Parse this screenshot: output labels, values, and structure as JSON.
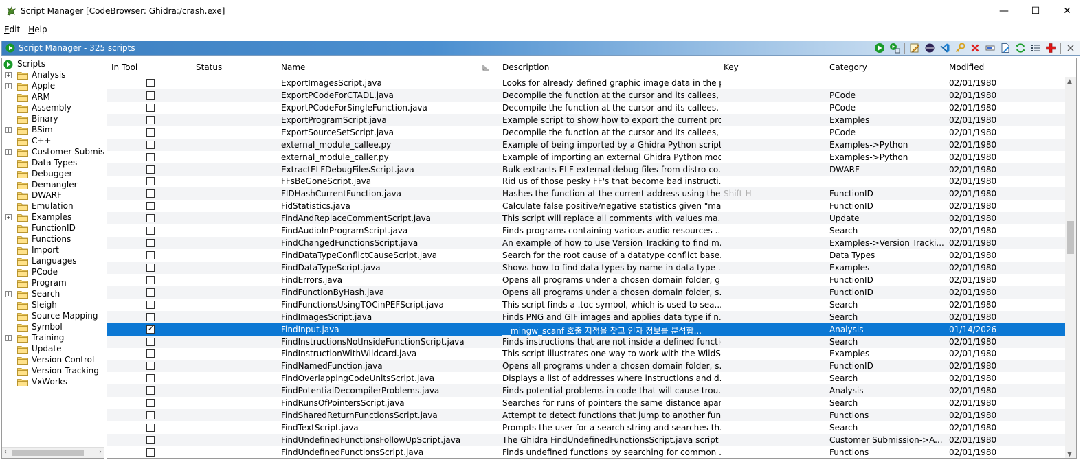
{
  "window": {
    "title": "Script Manager [CodeBrowser: Ghidra:/crash.exe]",
    "minimize": "—",
    "maximize": "☐",
    "close": "✕"
  },
  "menu": [
    {
      "label": "Edit",
      "mnemonic": "E",
      "rest": "dit"
    },
    {
      "label": "Help",
      "mnemonic": "H",
      "rest": "elp"
    }
  ],
  "panel": {
    "title": "Script Manager - 325 scripts"
  },
  "toolbar_icons": [
    "run-script-icon",
    "run-last-script-icon",
    "edit-script-icon",
    "eclipse-icon",
    "vscode-icon",
    "key-binding-icon",
    "delete-script-icon",
    "rename-icon",
    "new-script-icon",
    "refresh-icon",
    "script-directories-icon",
    "create-script-icon",
    "close-panel-icon"
  ],
  "tree": {
    "root": "Scripts",
    "items": [
      {
        "label": "Analysis",
        "expandable": true
      },
      {
        "label": "Apple",
        "expandable": true
      },
      {
        "label": "ARM",
        "expandable": false
      },
      {
        "label": "Assembly",
        "expandable": false
      },
      {
        "label": "Binary",
        "expandable": false
      },
      {
        "label": "BSim",
        "expandable": true
      },
      {
        "label": "C++",
        "expandable": false
      },
      {
        "label": "Customer Submiss",
        "expandable": true
      },
      {
        "label": "Data Types",
        "expandable": false
      },
      {
        "label": "Debugger",
        "expandable": false
      },
      {
        "label": "Demangler",
        "expandable": false
      },
      {
        "label": "DWARF",
        "expandable": false
      },
      {
        "label": "Emulation",
        "expandable": false
      },
      {
        "label": "Examples",
        "expandable": true
      },
      {
        "label": "FunctionID",
        "expandable": false
      },
      {
        "label": "Functions",
        "expandable": false
      },
      {
        "label": "Import",
        "expandable": false
      },
      {
        "label": "Languages",
        "expandable": false
      },
      {
        "label": "PCode",
        "expandable": false
      },
      {
        "label": "Program",
        "expandable": false
      },
      {
        "label": "Search",
        "expandable": true
      },
      {
        "label": "Sleigh",
        "expandable": false
      },
      {
        "label": "Source Mapping",
        "expandable": false
      },
      {
        "label": "Symbol",
        "expandable": false
      },
      {
        "label": "Training",
        "expandable": true
      },
      {
        "label": "Update",
        "expandable": false
      },
      {
        "label": "Version Control",
        "expandable": false
      },
      {
        "label": "Version Tracking",
        "expandable": false
      },
      {
        "label": "VxWorks",
        "expandable": false
      }
    ]
  },
  "table": {
    "columns": [
      "In Tool",
      "Status",
      "Name",
      "Description",
      "Key",
      "Category",
      "Modified"
    ],
    "rows": [
      {
        "in_tool": false,
        "status": "",
        "name": "ExportImagesScript.java",
        "description": "Looks for already defined graphic image data in the p...",
        "key": "",
        "category": "",
        "modified": "02/01/1980"
      },
      {
        "in_tool": false,
        "status": "",
        "name": "ExportPCodeForCTADL.java",
        "description": "Decompile the function at the cursor and its callees, t...",
        "key": "",
        "category": "PCode",
        "modified": "02/01/1980"
      },
      {
        "in_tool": false,
        "status": "",
        "name": "ExportPCodeForSingleFunction.java",
        "description": "Decompile the function at the cursor and its callees, t...",
        "key": "",
        "category": "PCode",
        "modified": "02/01/1980"
      },
      {
        "in_tool": false,
        "status": "",
        "name": "ExportProgramScript.java",
        "description": "Example script to show how to export the current pro...",
        "key": "",
        "category": "Examples",
        "modified": "02/01/1980"
      },
      {
        "in_tool": false,
        "status": "",
        "name": "ExportSourceSetScript.java",
        "description": "Decompile the function at the cursor and its callees, t...",
        "key": "",
        "category": "PCode",
        "modified": "02/01/1980"
      },
      {
        "in_tool": false,
        "status": "",
        "name": "external_module_callee.py",
        "description": "Example of being imported by a Ghidra Python script...",
        "key": "",
        "category": "Examples->Python",
        "modified": "02/01/1980"
      },
      {
        "in_tool": false,
        "status": "",
        "name": "external_module_caller.py",
        "description": "Example of importing an external Ghidra Python mod...",
        "key": "",
        "category": "Examples->Python",
        "modified": "02/01/1980"
      },
      {
        "in_tool": false,
        "status": "",
        "name": "ExtractELFDebugFilesScript.java",
        "description": "Bulk extracts ELF external debug files from distro co...",
        "key": "",
        "category": "DWARF",
        "modified": "02/01/1980"
      },
      {
        "in_tool": false,
        "status": "",
        "name": "FFsBeGoneScript.java",
        "description": "Rid us of those pesky FF's that become bad instructi...",
        "key": "",
        "category": "",
        "modified": "02/01/1980"
      },
      {
        "in_tool": false,
        "status": "",
        "name": "FIDHashCurrentFunction.java",
        "description": "Hashes the function at the current address using the ...",
        "key": "Shift-H",
        "category": "FunctionID",
        "modified": "02/01/1980"
      },
      {
        "in_tool": false,
        "status": "",
        "name": "FidStatistics.java",
        "description": "Calculate false positive/negative statistics given \"mar...",
        "key": "",
        "category": "FunctionID",
        "modified": "02/01/1980"
      },
      {
        "in_tool": false,
        "status": "",
        "name": "FindAndReplaceCommentScript.java",
        "description": "This script will replace all comments with values ma...",
        "key": "",
        "category": "Update",
        "modified": "02/01/1980"
      },
      {
        "in_tool": false,
        "status": "",
        "name": "FindAudioInProgramScript.java",
        "description": "Finds programs containing various audio resources ...",
        "key": "",
        "category": "Search",
        "modified": "02/01/1980"
      },
      {
        "in_tool": false,
        "status": "",
        "name": "FindChangedFunctionsScript.java",
        "description": "An example of how to use Version Tracking to find m...",
        "key": "",
        "category": "Examples->Version Tracki...",
        "modified": "02/01/1980"
      },
      {
        "in_tool": false,
        "status": "",
        "name": "FindDataTypeConflictCauseScript.java",
        "description": "Search for the root cause of a datatype conflict base...",
        "key": "",
        "category": "Data Types",
        "modified": "02/01/1980"
      },
      {
        "in_tool": false,
        "status": "",
        "name": "FindDataTypeScript.java",
        "description": "Shows how to find data types by name in data type ...",
        "key": "",
        "category": "Examples",
        "modified": "02/01/1980"
      },
      {
        "in_tool": false,
        "status": "",
        "name": "FindErrors.java",
        "description": "Opens all programs under a chosen domain folder, g...",
        "key": "",
        "category": "FunctionID",
        "modified": "02/01/1980"
      },
      {
        "in_tool": false,
        "status": "",
        "name": "FindFunctionByHash.java",
        "description": "Opens all programs under a chosen domain folder, s...",
        "key": "",
        "category": "FunctionID",
        "modified": "02/01/1980"
      },
      {
        "in_tool": false,
        "status": "",
        "name": "FindFunctionsUsingTOCinPEFScript.java",
        "description": "This script finds a .toc symbol, which is used to sea...",
        "key": "",
        "category": "Search",
        "modified": "02/01/1980"
      },
      {
        "in_tool": false,
        "status": "",
        "name": "FindImagesScript.java",
        "description": "Finds PNG and GIF images and applies data type if n...",
        "key": "",
        "category": "Search",
        "modified": "02/01/1980"
      },
      {
        "in_tool": true,
        "status": "",
        "name": "FindInput.java",
        "description": "__mingw_scanf 호출 지점을 찾고 인자 정보를 분석합...",
        "key": "",
        "category": "Analysis",
        "modified": "01/14/2026",
        "selected": true
      },
      {
        "in_tool": false,
        "status": "",
        "name": "FindInstructionsNotInsideFunctionScript.java",
        "description": "Finds instructions that are not inside a defined functio...",
        "key": "",
        "category": "Search",
        "modified": "02/01/1980"
      },
      {
        "in_tool": false,
        "status": "",
        "name": "FindInstructionWithWildcard.java",
        "description": "This script illustrates one way to work with the WildSl...",
        "key": "",
        "category": "Examples",
        "modified": "02/01/1980"
      },
      {
        "in_tool": false,
        "status": "",
        "name": "FindNamedFunction.java",
        "description": "Opens all programs under a chosen domain folder, s...",
        "key": "",
        "category": "FunctionID",
        "modified": "02/01/1980"
      },
      {
        "in_tool": false,
        "status": "",
        "name": "FindOverlappingCodeUnitsScript.java",
        "description": "Displays a list of addresses where instructions and d...",
        "key": "",
        "category": "Search",
        "modified": "02/01/1980"
      },
      {
        "in_tool": false,
        "status": "",
        "name": "FindPotentialDecompilerProblems.java",
        "description": "Finds potential problems in code that will cause trou...",
        "key": "",
        "category": "Analysis",
        "modified": "02/01/1980"
      },
      {
        "in_tool": false,
        "status": "",
        "name": "FindRunsOfPointersScript.java",
        "description": "Searches for runs of pointers the same distance apart.",
        "key": "",
        "category": "Search",
        "modified": "02/01/1980"
      },
      {
        "in_tool": false,
        "status": "",
        "name": "FindSharedReturnFunctionsScript.java",
        "description": " Attempt to detect functions that jump to another funct...",
        "key": "",
        "category": "Functions",
        "modified": "02/01/1980"
      },
      {
        "in_tool": false,
        "status": "",
        "name": "FindTextScript.java",
        "description": "Prompts the user for a search string and searches th...",
        "key": "",
        "category": "Search",
        "modified": "02/01/1980"
      },
      {
        "in_tool": false,
        "status": "",
        "name": "FindUndefinedFunctionsFollowUpScript.java",
        "description": "The Ghidra FindUndefinedFunctionsScript.java script ...",
        "key": "",
        "category": "Customer Submission->A...",
        "modified": "02/01/1980"
      },
      {
        "in_tool": false,
        "status": "",
        "name": "FindUndefinedFunctionsScript.java",
        "description": "Finds undefined functions by searching for common ...",
        "key": "",
        "category": "Functions",
        "modified": "02/01/1980"
      }
    ]
  }
}
